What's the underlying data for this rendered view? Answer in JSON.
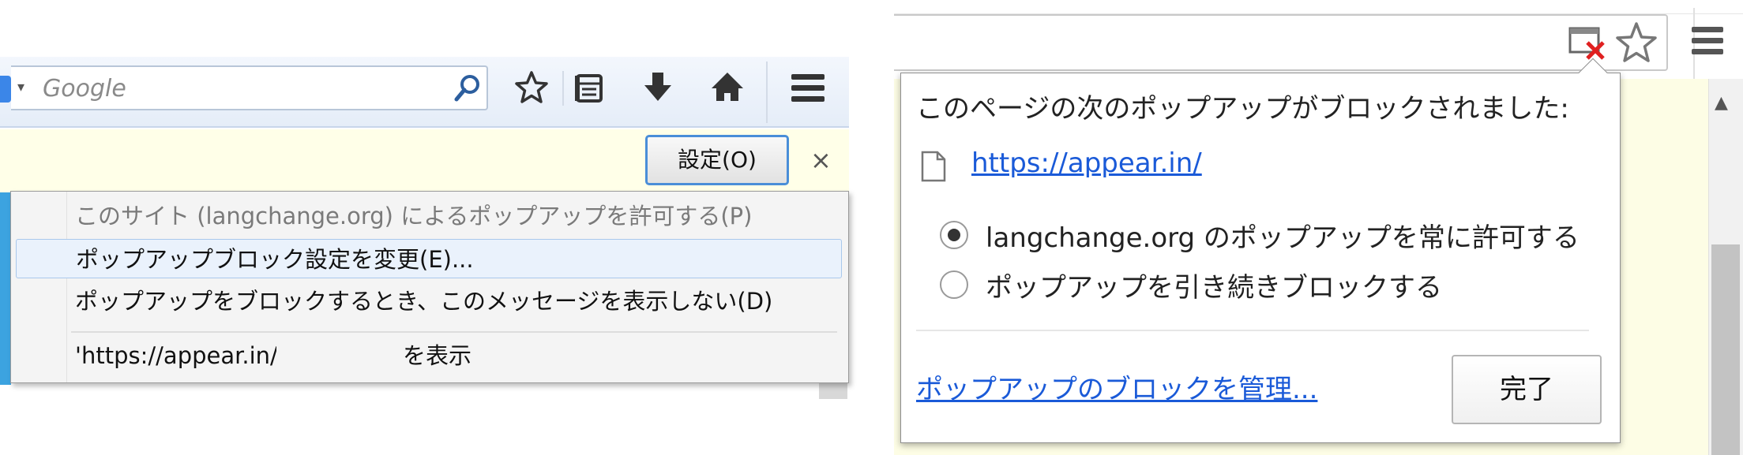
{
  "firefox": {
    "search": {
      "engine_icon": "search-engine-icon",
      "placeholder": "Google",
      "search_icon": "magnifier-icon"
    },
    "toolbar_icons": [
      "bookmark-star-icon",
      "reading-list-icon",
      "download-arrow-icon",
      "home-icon",
      "hamburger-menu-icon"
    ],
    "notification": {
      "settings_button": "設定(O)",
      "close_label": "×"
    },
    "menu": {
      "items": [
        "このサイト (langchange.org) によるポップアップを許可する(P)",
        "ポップアップブロック設定を変更(E)...",
        "ポップアップをブロックするとき、このメッセージを表示しない(D)",
        "'https://appear.in/                    を表示"
      ],
      "item_4_suffix": "を表示",
      "item_4_prefix": "'https://appear.in/"
    },
    "colors": {
      "highlight_border": "#a9c8ec",
      "notif_bg": "#ffffe8",
      "accent": "#3ca3e0"
    }
  },
  "chrome": {
    "toolbar_icons": [
      "popup-blocked-icon",
      "bookmark-star-icon",
      "hamburger-menu-icon"
    ],
    "bubble": {
      "title": "このページの次のポップアップがブロックされました:",
      "url": "https://appear.in/",
      "option_allow": "langchange.org のポップアップを常に許可する",
      "option_block": "ポップアップを引き続きブロックする",
      "selected_option": "option_allow",
      "manage_link": "ポップアップのブロックを管理...",
      "done_button": "完了"
    },
    "colors": {
      "link": "#1a5ad8",
      "blocked_x": "#e02020",
      "page_bg": "#fdfde5"
    }
  }
}
